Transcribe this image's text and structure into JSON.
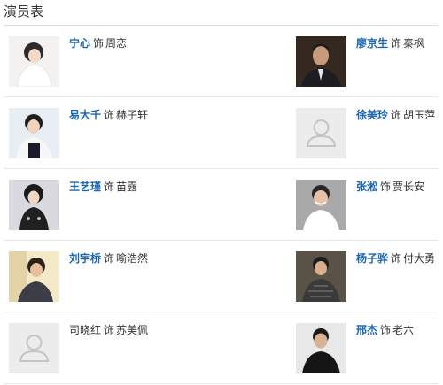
{
  "section": {
    "title": "演员表"
  },
  "as_word": "饰",
  "cast": [
    {
      "actor": "宁心",
      "role": "周恋",
      "linked": true,
      "photo": "woman-white-dress-photo"
    },
    {
      "actor": "廖京生",
      "role": "秦枫",
      "linked": true,
      "photo": "man-suit-photo"
    },
    {
      "actor": "易大千",
      "role": "赫子轩",
      "linked": true,
      "photo": "young-man-photo"
    },
    {
      "actor": "徐美玲",
      "role": "胡玉萍",
      "linked": true,
      "photo": "default-avatar-placeholder"
    },
    {
      "actor": "王艺瑾",
      "role": "苗露",
      "linked": true,
      "photo": "girl-dark-outfit-photo"
    },
    {
      "actor": "张淞",
      "role": "贾长安",
      "linked": true,
      "photo": "man-smiling-photo"
    },
    {
      "actor": "刘宇桥",
      "role": "喻浩然",
      "linked": true,
      "photo": "young-man-outdoor-photo"
    },
    {
      "actor": "杨子骅",
      "role": "付大勇",
      "linked": true,
      "photo": "man-plaid-jacket-photo"
    },
    {
      "actor": "司晓红",
      "role": "苏美佩",
      "linked": false,
      "photo": "default-avatar-placeholder"
    },
    {
      "actor": "邢杰",
      "role": "老六",
      "linked": true,
      "photo": "man-black-jacket-photo"
    }
  ]
}
